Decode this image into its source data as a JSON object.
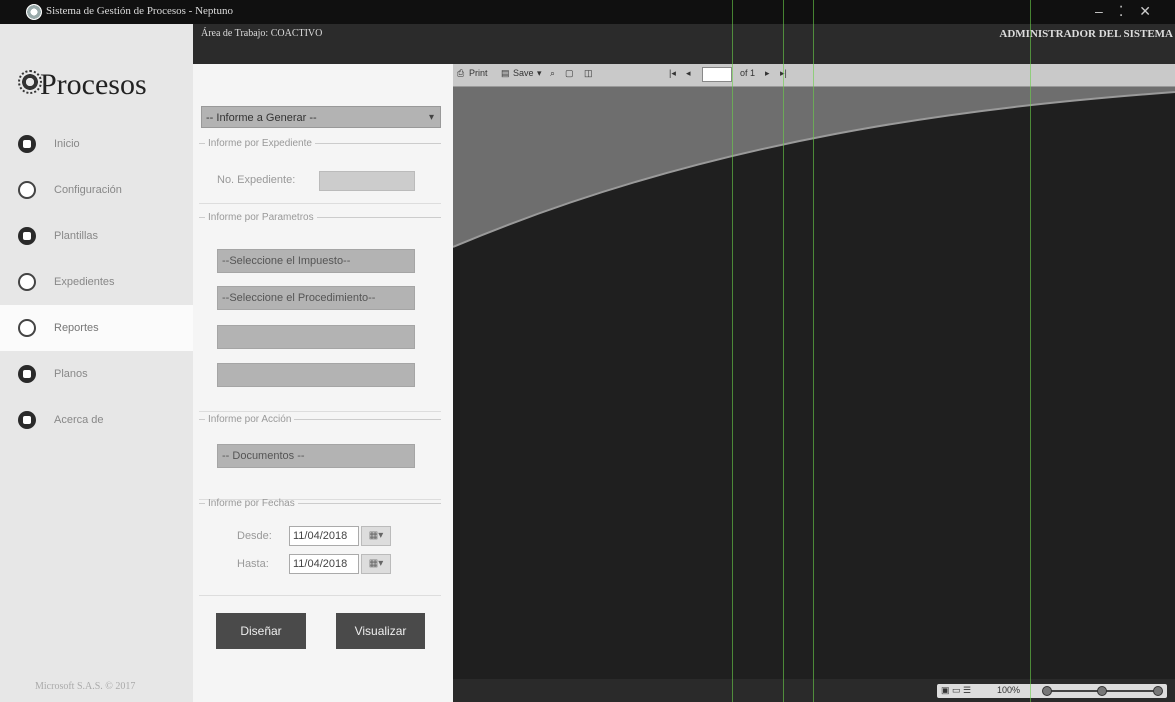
{
  "window": {
    "title": "Sistema de Gestión de Procesos - Neptuno",
    "area_label": "Área de Trabajo: COACTIVO",
    "user_label": "ADMINISTRADOR DEL SISTEMA"
  },
  "sidebar": {
    "logo_text": "Procesos",
    "items": [
      {
        "label": "Inicio",
        "icon": "home-icon"
      },
      {
        "label": "Configuración",
        "icon": "settings-icon"
      },
      {
        "label": "Plantillas",
        "icon": "pencil-icon"
      },
      {
        "label": "Expedientes",
        "icon": "folder-icon"
      },
      {
        "label": "Reportes",
        "icon": "chart-icon",
        "active": true
      },
      {
        "label": "Planos",
        "icon": "database-icon"
      },
      {
        "label": "Acerca de",
        "icon": "info-icon"
      }
    ],
    "footer": "Microsoft S.A.S. © 2017"
  },
  "form": {
    "report_select": "-- Informe a Generar --",
    "section_expediente": "Informe por Expediente",
    "expediente_label": "No. Expediente:",
    "expediente_value": "",
    "section_parametros": "Informe por Parametros",
    "impuesto_select": "--Seleccione el Impuesto--",
    "procedimiento_select": "--Seleccione el Procedimiento--",
    "param_select_3": "",
    "param_select_4": "",
    "section_accion": "Informe por Acción",
    "documentos_select": "-- Documentos --",
    "section_fechas": "Informe por Fechas",
    "desde_label": "Desde:",
    "desde_value": "11/04/2018",
    "hasta_label": "Hasta:",
    "hasta_value": "11/04/2018",
    "design_button": "Diseñar",
    "view_button": "Visualizar"
  },
  "viewer": {
    "print_label": "Print",
    "save_label": "Save",
    "page_value": "",
    "page_of": "of 1",
    "zoom_label": "100%"
  }
}
